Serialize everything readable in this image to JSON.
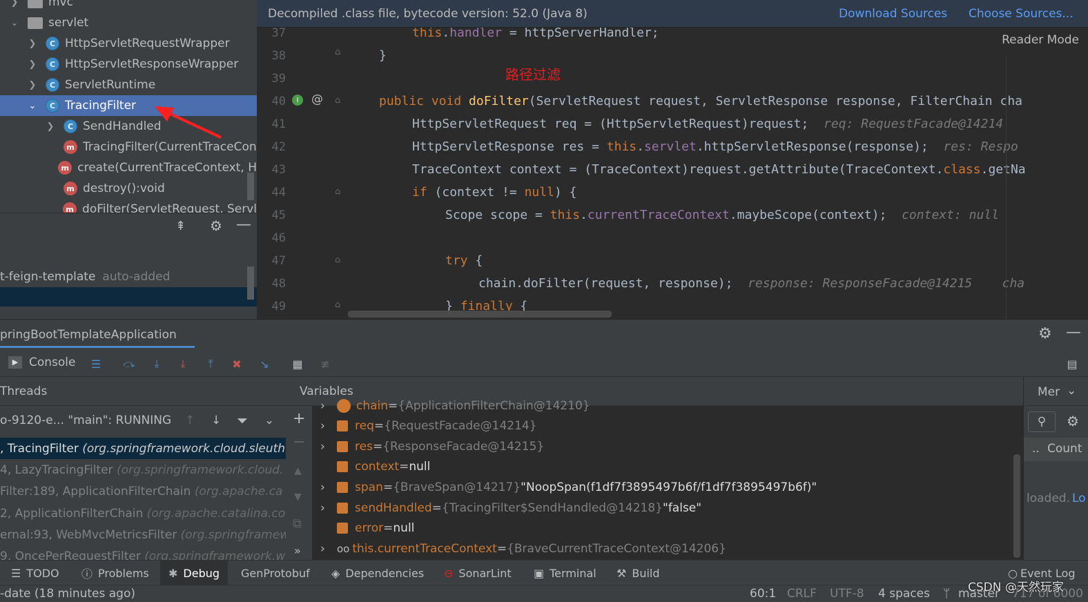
{
  "project_tree": {
    "rows": [
      {
        "label": "mvc"
      },
      {
        "label": "servlet"
      },
      {
        "label": "HttpServletRequestWrapper"
      },
      {
        "label": "HttpServletResponseWrapper"
      },
      {
        "label": "ServletRuntime"
      },
      {
        "label": "TracingFilter"
      },
      {
        "label": "SendHandled"
      },
      {
        "label": "TracingFilter(CurrentTraceCon"
      },
      {
        "label": "create(CurrentTraceContext, H"
      },
      {
        "label": "destroy():void"
      },
      {
        "label": "doFilter(ServletRequest, Servl"
      }
    ],
    "icon_c": "C",
    "icon_m": "m"
  },
  "left_panel": {
    "item": "t-feign-template",
    "item_tag": "auto-added"
  },
  "notification": {
    "text": "Decompiled .class file, bytecode version: 52.0 (Java 8)",
    "download_sources": "Download Sources",
    "choose_sources": "Choose Sources..."
  },
  "editor": {
    "reader_mode": "Reader Mode",
    "annotation": "路径过滤",
    "gutter_at": "@",
    "line_numbers": [
      "37",
      "38",
      "39",
      "40",
      "41",
      "42",
      "43",
      "44",
      "45",
      "46",
      "47",
      "48",
      "49"
    ]
  },
  "code": {
    "l37": {
      "a": "this",
      "b": ".",
      "c": "handler",
      "d": " = httpServerHandler;"
    },
    "l38": {
      "a": "}"
    },
    "l40": {
      "a": "public void ",
      "b": "doFilter",
      "c": "(ServletRequest request, ServletResponse response, FilterChain cha"
    },
    "l41": {
      "a": "HttpServletRequest req = (HttpServletRequest)request;",
      "hint": "req: RequestFacade@14214"
    },
    "l42": {
      "a": "HttpServletResponse res = ",
      "b": "this",
      "c": ".",
      "d": "servlet",
      "e": ".httpServletResponse(response);",
      "hint": "res: Respo"
    },
    "l43": {
      "a": "TraceContext context = (TraceContext)request.getAttribute(TraceContext.",
      "b": "class",
      "c": ".getNa"
    },
    "l44": {
      "a": "if",
      "b": " (context != ",
      "c": "null",
      "d": ") {"
    },
    "l45": {
      "a": "Scope scope = ",
      "b": "this",
      "c": ".",
      "d": "currentTraceContext",
      "e": ".maybeScope(context);",
      "hint": "context: null"
    },
    "l47": {
      "a": "try",
      "b": " {"
    },
    "l48": {
      "a": "chain.doFilter(request, response);",
      "hint": "response: ResponseFacade@14215",
      "hint2": "cha"
    },
    "l49": {
      "a": "} ",
      "b": "finally",
      "c": " {"
    }
  },
  "debug": {
    "run_config": "pringBootTemplateApplication",
    "console_tab": "Console",
    "threads_label": "Threads",
    "thread_selector": "o-9120-e... \"main\": RUNNING",
    "variables_label": "Variables",
    "memory_tab": "Mer",
    "memory_count": "Count",
    "memory_dots": "..",
    "memory_loaded": "loaded.",
    "memory_link": "Lo"
  },
  "frames": [
    {
      "name": ", TracingFilter",
      "pkg": "(org.springframework.cloud.sleuth"
    },
    {
      "name": "4, LazyTracingFilter",
      "pkg": "(org.springframework.cloud."
    },
    {
      "name": "Filter:189, ApplicationFilterChain",
      "pkg": "(org.apache.ca"
    },
    {
      "name": "2, ApplicationFilterChain",
      "pkg": "(org.apache.catalina.co"
    },
    {
      "name": "ernal:93, WebMvcMetricsFilter",
      "pkg": "(org.springframew"
    },
    {
      "name": "9, OncePerRequestFilter",
      "pkg": "(org.springframework.w"
    }
  ],
  "variables": [
    {
      "name": "chain",
      "eq": " = ",
      "ref": "{ApplicationFilterChain@14210}",
      "val": ""
    },
    {
      "name": "req",
      "eq": " = ",
      "ref": "{RequestFacade@14214}",
      "val": ""
    },
    {
      "name": "res",
      "eq": " = ",
      "ref": "{ResponseFacade@14215}",
      "val": ""
    },
    {
      "name": "context",
      "eq": " = ",
      "ref": "",
      "val": "null"
    },
    {
      "name": "span",
      "eq": " = ",
      "ref": "{BraveSpan@14217}",
      "val": " \"NoopSpan(f1df7f3895497b6f/f1df7f3895497b6f)\""
    },
    {
      "name": "sendHandled",
      "eq": " = ",
      "ref": "{TracingFilter$SendHandled@14218}",
      "val": " \"false\""
    },
    {
      "name": "error",
      "eq": " = ",
      "ref": "",
      "val": "null"
    },
    {
      "name": "this.currentTraceContext",
      "eq": " = ",
      "ref": "{BraveCurrentTraceContext@14206}",
      "val": ""
    }
  ],
  "tool_windows": {
    "todo": "TODO",
    "problems": "Problems",
    "debug": "Debug",
    "genprotobuf": "GenProtobuf",
    "dependencies": "Dependencies",
    "sonarlint": "SonarLint",
    "terminal": "Terminal",
    "build": "Build",
    "event_log": "Event Log"
  },
  "status_bar": {
    "message": "-date (18 minutes ago)",
    "position": "60:1",
    "line_sep": "CRLF",
    "encoding": "UTF-8",
    "indent": "4 spaces",
    "branch": "master",
    "memory": "717 of 6000",
    "watermark": "CSDN @天然玩家"
  },
  "colors": {
    "selection": "#4b6eaf",
    "link": "#589df6",
    "keyword": "#cc7832",
    "field": "#9876aa",
    "method": "#ffc66d",
    "annotation_red": "#e02020",
    "arrow_red": "#ff2020"
  }
}
